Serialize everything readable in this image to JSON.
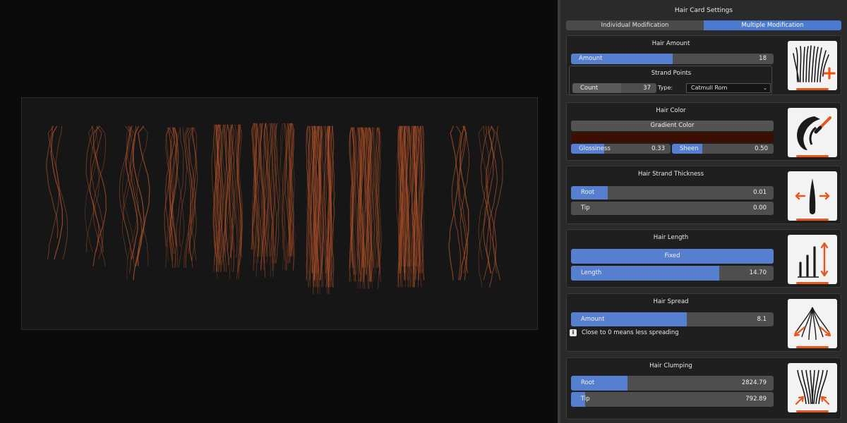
{
  "panel": {
    "title": "Hair Card Settings",
    "tabs": [
      {
        "label": "Individual Modification",
        "active": false
      },
      {
        "label": "Multiple Modification",
        "active": true
      }
    ]
  },
  "hair_amount": {
    "title": "Hair Amount",
    "amount": {
      "label": "Amount",
      "value": "18",
      "fraction": 0.5
    },
    "strand_points": {
      "title": "Strand Points",
      "count": {
        "label": "Count",
        "value": "37",
        "fraction": 0.58
      },
      "type_label": "Type:",
      "type_value": "Catmull Rom"
    },
    "icon": "hair-add-icon"
  },
  "hair_color": {
    "title": "Hair Color",
    "gradient_label": "Gradient Color",
    "swatch_color": "#3c0f04",
    "glossiness": {
      "label": "Glossiness",
      "value": "0.33",
      "fraction": 0.33
    },
    "sheen": {
      "label": "Sheen",
      "value": "0.50",
      "fraction": 0.3
    },
    "icon": "hair-brush-icon"
  },
  "thickness": {
    "title": "Hair Strand Thickness",
    "root": {
      "label": "Root",
      "value": "0.01",
      "fraction": 0.18
    },
    "tip": {
      "label": "Tip",
      "value": "0.00",
      "fraction": 0.0
    },
    "icon": "strand-thickness-icon"
  },
  "length": {
    "title": "Hair Length",
    "mode_label": "Fixed",
    "length": {
      "label": "Length",
      "value": "14.70",
      "fraction": 0.73
    },
    "icon": "length-bars-icon"
  },
  "spread": {
    "title": "Hair Spread",
    "amount": {
      "label": "Amount",
      "value": "8.1",
      "fraction": 0.57
    },
    "info": "Close to 0 means less spreading",
    "icon": "spread-icon"
  },
  "clumping": {
    "title": "Hair Clumping",
    "root": {
      "label": "Root",
      "value": "2824.79",
      "fraction": 0.28
    },
    "tip": {
      "label": "Tip",
      "value": "792.89",
      "fraction": 0.07
    },
    "icon": "clumping-icon"
  },
  "colors": {
    "accent": "#5680cf",
    "orange": "#e8571b",
    "hair": "#b4532a"
  }
}
